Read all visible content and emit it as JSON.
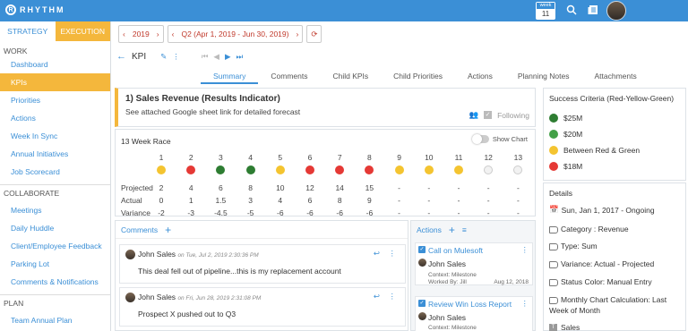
{
  "app": {
    "name": "RHYTHM",
    "week_label": "week",
    "week_number": "11"
  },
  "sidebar": {
    "tabs": [
      {
        "label": "STRATEGY"
      },
      {
        "label": "EXECUTION"
      }
    ],
    "work_label": "WORK",
    "work": [
      {
        "label": "Dashboard"
      },
      {
        "label": "KPIs"
      },
      {
        "label": "Priorities"
      },
      {
        "label": "Actions"
      },
      {
        "label": "Week In Sync"
      },
      {
        "label": "Annual Initiatives"
      },
      {
        "label": "Job Scorecard"
      }
    ],
    "collaborate_label": "COLLABORATE",
    "collaborate": [
      {
        "label": "Meetings"
      },
      {
        "label": "Daily Huddle"
      },
      {
        "label": "Client/Employee Feedback"
      },
      {
        "label": "Parking Lot"
      },
      {
        "label": "Comments & Notifications"
      }
    ],
    "plan_label": "PLAN",
    "plan": [
      {
        "label": "Team Annual Plan"
      }
    ]
  },
  "filters": {
    "year": "2019",
    "quarter": "Q2 (Apr 1, 2019 - Jun 30, 2019)"
  },
  "kpi": {
    "title": "KPI"
  },
  "tabs": [
    {
      "label": "Summary"
    },
    {
      "label": "Comments"
    },
    {
      "label": "Child KPIs"
    },
    {
      "label": "Child Priorities"
    },
    {
      "label": "Actions"
    },
    {
      "label": "Planning Notes"
    },
    {
      "label": "Attachments"
    }
  ],
  "indicator": {
    "title": "1) Sales Revenue (Results Indicator)",
    "description": "See attached Google sheet link for detailed forecast",
    "following": "Following"
  },
  "race": {
    "title": "13 Week Race",
    "toggle_label": "Show Chart",
    "row_labels": [
      "Projected",
      "Actual",
      "Variance"
    ],
    "weeks": [
      {
        "w": "1",
        "projected": "2",
        "actual": "0",
        "variance": "-2",
        "status": "yellow"
      },
      {
        "w": "2",
        "projected": "4",
        "actual": "1",
        "variance": "-3",
        "status": "red"
      },
      {
        "w": "3",
        "projected": "6",
        "actual": "1.5",
        "variance": "-4.5",
        "status": "green"
      },
      {
        "w": "4",
        "projected": "8",
        "actual": "3",
        "variance": "-5",
        "status": "green"
      },
      {
        "w": "5",
        "projected": "10",
        "actual": "4",
        "variance": "-6",
        "status": "yellow"
      },
      {
        "w": "6",
        "projected": "12",
        "actual": "6",
        "variance": "-6",
        "status": "red"
      },
      {
        "w": "7",
        "projected": "14",
        "actual": "8",
        "variance": "-6",
        "status": "red"
      },
      {
        "w": "8",
        "projected": "15",
        "actual": "9",
        "variance": "-6",
        "status": "red"
      },
      {
        "w": "9",
        "projected": "-",
        "actual": "-",
        "variance": "-",
        "status": "yellow"
      },
      {
        "w": "10",
        "projected": "-",
        "actual": "-",
        "variance": "-",
        "status": "yellow"
      },
      {
        "w": "11",
        "projected": "-",
        "actual": "-",
        "variance": "-",
        "status": "yellow"
      },
      {
        "w": "12",
        "projected": "-",
        "actual": "-",
        "variance": "-",
        "status": "empty"
      },
      {
        "w": "13",
        "projected": "-",
        "actual": "-",
        "variance": "-",
        "status": "empty"
      }
    ]
  },
  "comments": {
    "header": "Comments",
    "items": [
      {
        "author": "John Sales",
        "date": "on Tue, Jul 2, 2019 2:30:36 PM",
        "text": "This deal fell out of pipeline...this is my replacement account"
      },
      {
        "author": "John Sales",
        "date": "on Fri, Jun 28, 2019 2:31:08 PM",
        "text": "Prospect X pushed out to Q3"
      }
    ]
  },
  "actions": {
    "header": "Actions",
    "items": [
      {
        "title": "Call on Mulesoft",
        "owner": "John Sales",
        "context": "Context: Milestone",
        "worked_by": "Worked By: Jill",
        "date": "Aug 12, 2018"
      },
      {
        "title": "Review Win Loss Report",
        "owner": "John Sales",
        "context": "Context: Milestone",
        "worked_by": "",
        "date": ""
      }
    ]
  },
  "criteria": {
    "title": "Success Criteria (Red-Yellow-Green)",
    "items": [
      {
        "label": "$25M",
        "color": "#2e7d32"
      },
      {
        "label": "$20M",
        "color": "#43a047"
      },
      {
        "label": "Between Red & Green",
        "color": "#f4c430"
      },
      {
        "label": "$18M",
        "color": "#e53935"
      }
    ]
  },
  "details": {
    "title": "Details",
    "date": "Sun, Jan 1, 2017 - Ongoing",
    "items": [
      {
        "label": "Category :  Revenue"
      },
      {
        "label": "Type: Sum"
      },
      {
        "label": "Variance: Actual - Projected"
      },
      {
        "label": "Status Color: Manual Entry"
      },
      {
        "label": "Monthly Chart Calculation: Last Week of Month"
      }
    ],
    "owner": "Sales"
  },
  "colors": {
    "primary": "#3b8fd6",
    "accent": "#f4b73c",
    "red": "#e53935",
    "green": "#2e7d32",
    "yellow": "#f4c430"
  }
}
